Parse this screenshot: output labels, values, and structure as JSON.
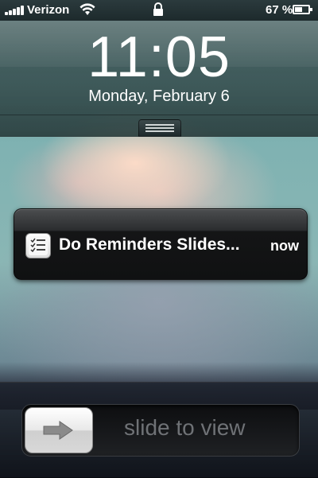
{
  "status_bar": {
    "carrier": "Verizon",
    "battery_percent": "67 %",
    "battery_level": 0.67
  },
  "lock_screen": {
    "time": "11:05",
    "date": "Monday, February 6"
  },
  "notification": {
    "app_icon": "reminders-icon",
    "title": "Do Reminders Slides...",
    "time": "now"
  },
  "unlock_slider": {
    "label": "slide to view",
    "knob_icon": "arrow-right-icon"
  }
}
